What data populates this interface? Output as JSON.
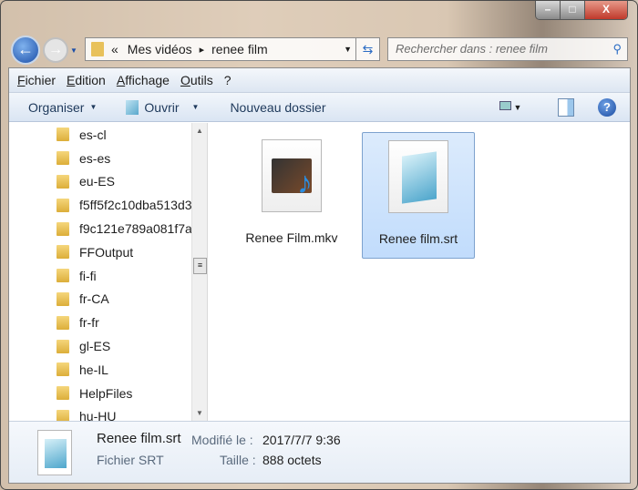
{
  "window": {
    "controls": {
      "minimize": "–",
      "maximize": "□",
      "close": "X"
    }
  },
  "address": {
    "overflow": "«",
    "crumbs": [
      "Mes vidéos",
      "renee film"
    ],
    "separator": "▸"
  },
  "search": {
    "placeholder": "Rechercher dans : renee film"
  },
  "menu": [
    "Fichier",
    "Edition",
    "Affichage",
    "Outils",
    "?"
  ],
  "toolbar": {
    "organise": "Organiser",
    "open": "Ouvrir",
    "new_folder": "Nouveau dossier"
  },
  "tree": [
    "es-cl",
    "es-es",
    "eu-ES",
    "f5ff5f2c10dba513d3",
    "f9c121e789a081f7a",
    "FFOutput",
    "fi-fi",
    "fr-CA",
    "fr-fr",
    "gl-ES",
    "he-IL",
    "HelpFiles",
    "hu-HU"
  ],
  "files": [
    {
      "name": "Renee Film.mkv",
      "selected": false
    },
    {
      "name": "Renee film.srt",
      "selected": true
    }
  ],
  "details": {
    "name": "Renee film.srt",
    "type": "Fichier SRT",
    "modified_label": "Modifié le :",
    "modified": "2017/7/7 9:36",
    "size_label": "Taille :",
    "size": "888 octets"
  }
}
